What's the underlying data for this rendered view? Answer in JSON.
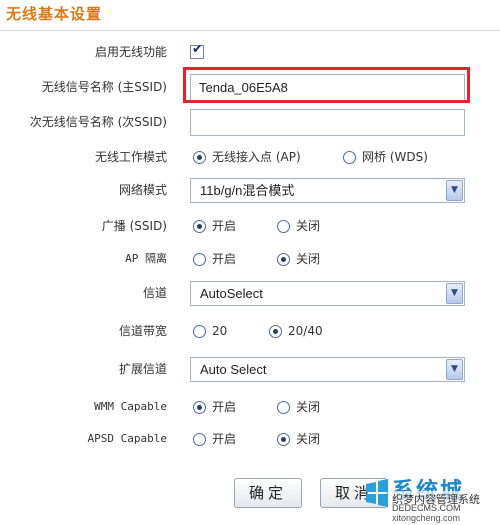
{
  "page": {
    "title": "无线基本设置"
  },
  "fields": {
    "enable_wireless": {
      "label": "启用无线功能",
      "checked": true,
      "check_glyph": "✔"
    },
    "primary_ssid": {
      "label": "无线信号名称 (主SSID)",
      "value": "Tenda_06E5A8"
    },
    "secondary_ssid": {
      "label": "次无线信号名称 (次SSID)",
      "value": ""
    },
    "work_mode": {
      "label": "无线工作模式",
      "options": [
        "无线接入点 (AP)",
        "网桥 (WDS)"
      ],
      "selected": 0
    },
    "network_mode": {
      "label": "网络模式",
      "value": "11b/g/n混合模式"
    },
    "broadcast": {
      "label": "广播 (SSID)",
      "options": [
        "开启",
        "关闭"
      ],
      "selected": 0
    },
    "ap_isolation": {
      "label": "AP 隔离",
      "options": [
        "开启",
        "关闭"
      ],
      "selected": 1
    },
    "channel": {
      "label": "信道",
      "value": "AutoSelect"
    },
    "bandwidth": {
      "label": "信道带宽",
      "options": [
        "20",
        "20/40"
      ],
      "selected": 1
    },
    "ext_channel": {
      "label": "扩展信道",
      "value": "Auto Select"
    },
    "wmm": {
      "label": "WMM Capable",
      "options": [
        "开启",
        "关闭"
      ],
      "selected": 0
    },
    "apsd": {
      "label": "APSD Capable",
      "options": [
        "开启",
        "关闭"
      ],
      "selected": 1
    }
  },
  "buttons": {
    "confirm": "确定",
    "cancel": "取消"
  },
  "icons": {
    "select_arrow": "▼"
  },
  "watermark": {
    "logo": "系统城",
    "subtitle": "织梦内容管理系统",
    "url_1": "DEDECMS.COM",
    "url_2": "xitongcheng.com"
  },
  "colors": {
    "title": "#d97a1a",
    "highlight": "#e0252e",
    "watermark": "#1f86c7"
  }
}
